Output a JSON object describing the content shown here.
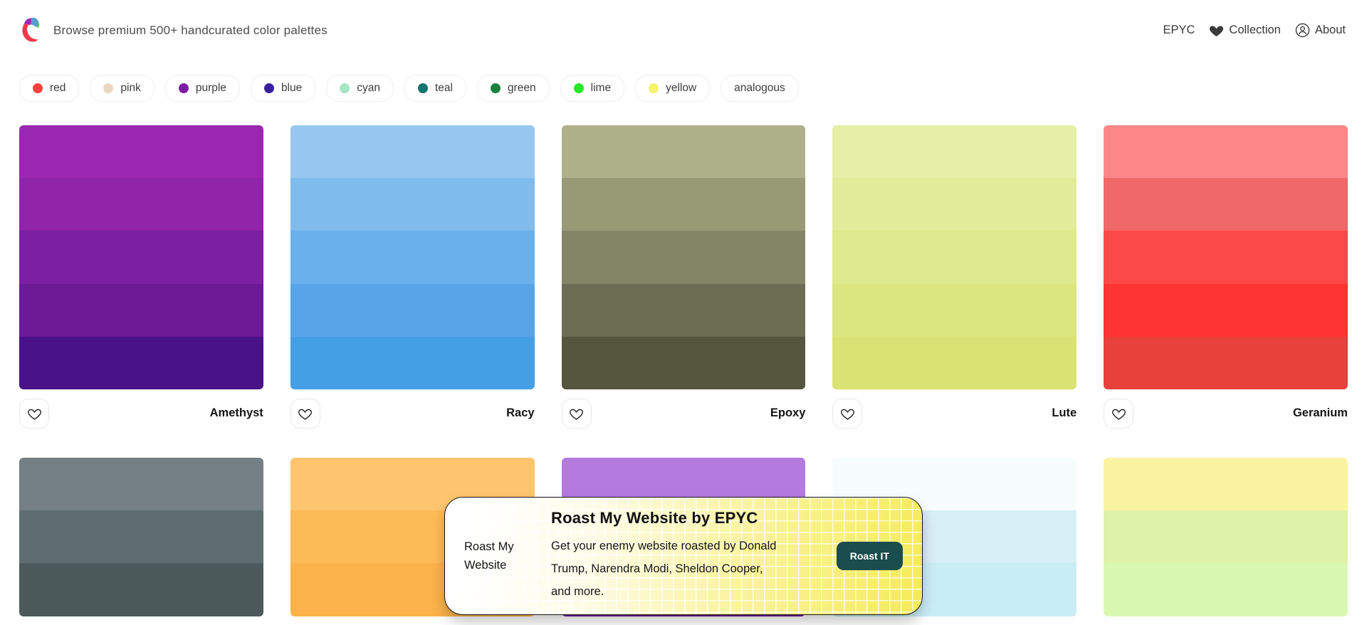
{
  "header": {
    "tagline": "Browse premium 500+ handcurated color palettes",
    "nav": [
      {
        "label": "EPYC",
        "icon": null
      },
      {
        "label": "Collection",
        "icon": "heart-icon"
      },
      {
        "label": "About",
        "icon": "person-icon"
      }
    ]
  },
  "filters": [
    {
      "label": "red",
      "dot": "#F8423C"
    },
    {
      "label": "pink",
      "dot": "#EAD7BF"
    },
    {
      "label": "purple",
      "dot": "#7D1CA4"
    },
    {
      "label": "blue",
      "dot": "#38219F"
    },
    {
      "label": "cyan",
      "dot": "#A5E6C3"
    },
    {
      "label": "teal",
      "dot": "#0E766F"
    },
    {
      "label": "green",
      "dot": "#17803D"
    },
    {
      "label": "lime",
      "dot": "#26E926"
    },
    {
      "label": "yellow",
      "dot": "#F7F26D"
    },
    {
      "label": "analogous",
      "dot": null
    }
  ],
  "gallery": {
    "rows": [
      {
        "cards": [
          {
            "name": "Amethyst",
            "colors": [
              "#9B27B0",
              "#9125A9",
              "#7C1FA1",
              "#6C1A96",
              "#4A1287"
            ]
          },
          {
            "name": "Racy",
            "colors": [
              "#97C7F0",
              "#80BBEE",
              "#6AB0EC",
              "#57A5E8",
              "#459FE5"
            ]
          },
          {
            "name": "Epoxy",
            "colors": [
              "#AEB08A",
              "#989A76",
              "#828566",
              "#6B6E53",
              "#54563E"
            ]
          },
          {
            "name": "Lute",
            "colors": [
              "#E5EFA5",
              "#E2EB9A",
              "#DFE98D",
              "#DCE680",
              "#D9E373"
            ]
          },
          {
            "name": "Geranium",
            "colors": [
              "#FC8787",
              "#F06868",
              "#FB4848",
              "#FE3333",
              "#E8403A"
            ]
          }
        ]
      },
      {
        "cards": [
          {
            "name": null,
            "colors": [
              "#748084",
              "#5E6E70",
              "#4C5A5B"
            ]
          },
          {
            "name": null,
            "colors": [
              "#FFC56E",
              "#FDBB58",
              "#FBB24B"
            ]
          },
          {
            "name": null,
            "colors": [
              "#B57ADE",
              "#9148B9",
              "#6D1795"
            ]
          },
          {
            "name": null,
            "colors": [
              "#F7FDFD",
              "#D8EEF5",
              "#C9EDF5"
            ]
          },
          {
            "name": null,
            "colors": [
              "#FAF3A2",
              "#DFF2A9",
              "#D8F8B2"
            ]
          }
        ]
      }
    ]
  },
  "popup": {
    "left_label": "Roast My Website",
    "title": "Roast My Website by EPYC",
    "description": "Get your enemy website roasted by Donald Trump, Narendra Modi, Sheldon Cooper, and more.",
    "button_label": "Roast IT",
    "button_color": "#1A4D4D",
    "border_color": "#141414"
  }
}
